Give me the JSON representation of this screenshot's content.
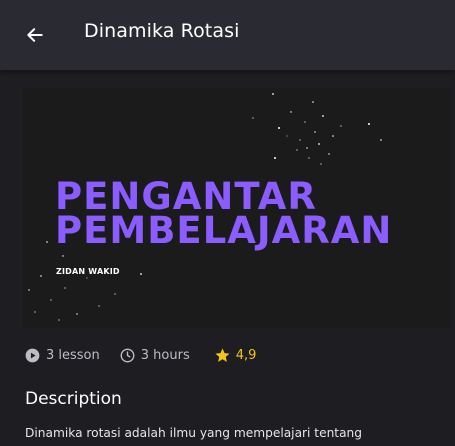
{
  "appbar": {
    "title": "Dinamika Rotasi",
    "back_icon": "arrow-left-icon"
  },
  "thumbnail": {
    "title_line1": "PENGANTAR",
    "title_line2": "PEMBELAJARAN",
    "author": "ZIDAN WAKID",
    "title_color": "#8b5cff",
    "background_color": "#1b1b1c"
  },
  "meta": {
    "lesson_icon": "play-circle-icon",
    "lesson_text": "3 lesson",
    "hours_icon": "clock-icon",
    "hours_text": "3 hours",
    "rating_icon": "star-icon",
    "rating_text": "4,9",
    "rating_color": "#f5c518"
  },
  "description": {
    "heading": "Description",
    "text": "Dinamika rotasi adalah ilmu yang mempelajari tentang"
  }
}
